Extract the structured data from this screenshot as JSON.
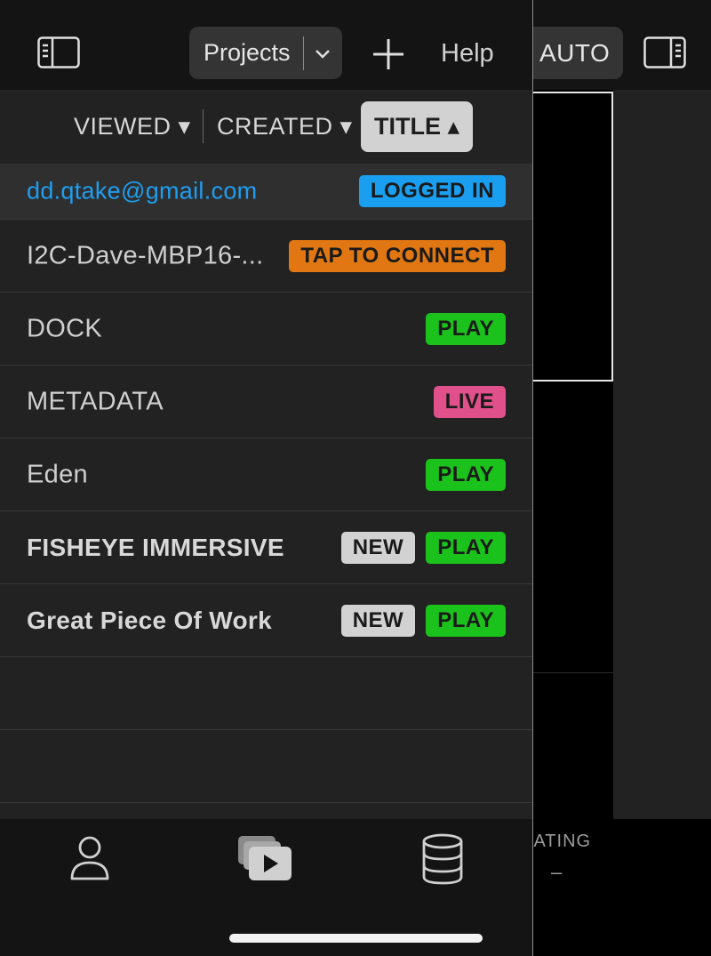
{
  "header": {
    "projects_label": "Projects",
    "help_label": "Help",
    "auto_label": "AUTO"
  },
  "sort": {
    "viewed": "VIEWED ▾",
    "created": "CREATED ▾",
    "title": "TITLE ▴",
    "active": "title"
  },
  "rows": [
    {
      "label": "dd.qtake@gmail.com",
      "badges": [
        {
          "text": "LOGGED IN",
          "color": "#1a9ef0"
        }
      ]
    },
    {
      "label": "I2C-Dave-MBP16-...",
      "badges": [
        {
          "text": "TAP TO CONNECT",
          "color": "#e07712"
        }
      ]
    },
    {
      "label": "DOCK",
      "badges": [
        {
          "text": "PLAY",
          "color": "#1bc21b"
        }
      ]
    },
    {
      "label": "METADATA",
      "badges": [
        {
          "text": "LIVE",
          "color": "#e0508a"
        }
      ]
    },
    {
      "label": "Eden",
      "badges": [
        {
          "text": "PLAY",
          "color": "#1bc21b"
        }
      ]
    },
    {
      "label": "FISHEYE IMMERSIVE",
      "badges": [
        {
          "text": "NEW",
          "color": "#d2d2d2"
        },
        {
          "text": "PLAY",
          "color": "#1bc21b"
        }
      ]
    },
    {
      "label": "Great Piece Of Work",
      "badges": [
        {
          "text": "NEW",
          "color": "#d2d2d2"
        },
        {
          "text": "PLAY",
          "color": "#1bc21b"
        }
      ]
    }
  ],
  "tabs": [
    {
      "icon": "user-icon"
    },
    {
      "icon": "media-play-icon"
    },
    {
      "icon": "database-icon"
    }
  ],
  "side_panel": {
    "rating_label": "RATING",
    "rating_value": "–"
  }
}
